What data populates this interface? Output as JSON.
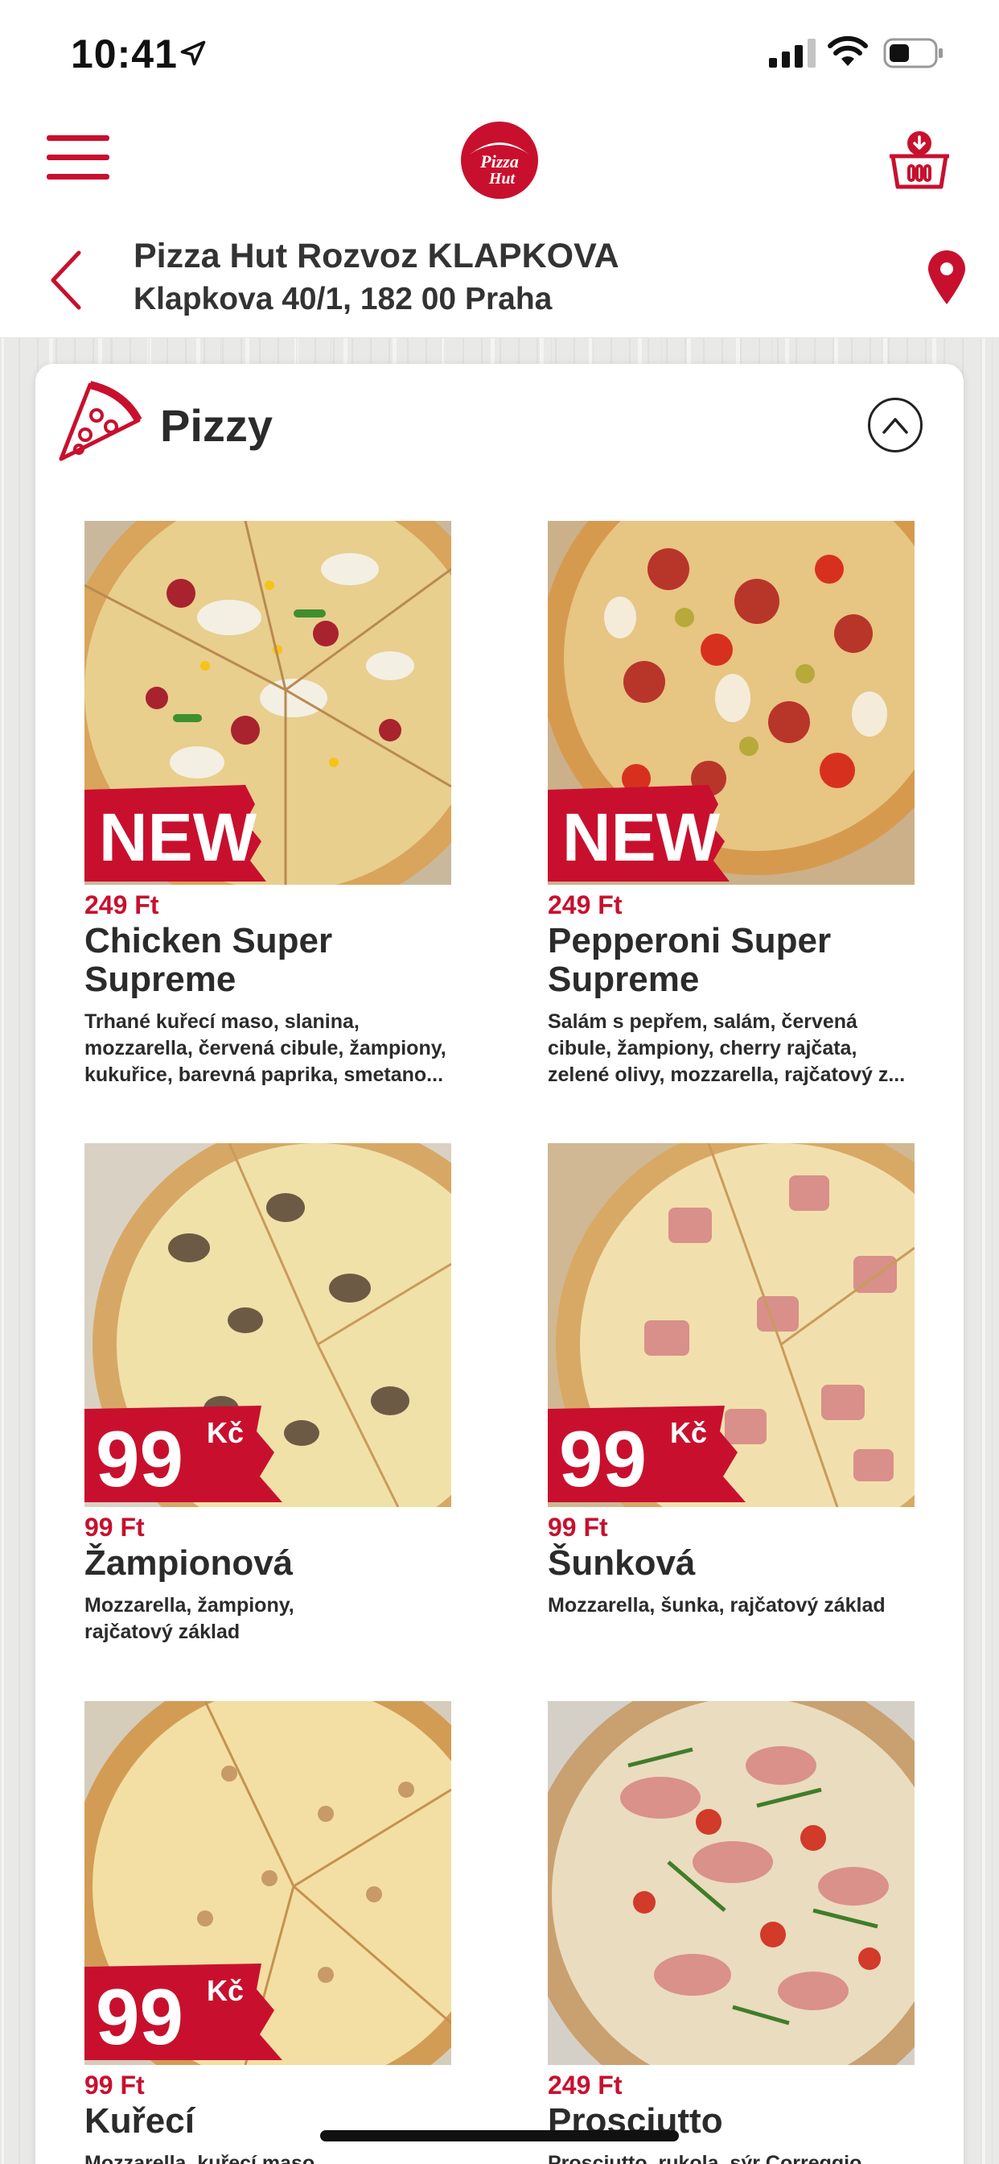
{
  "status_bar": {
    "time": "10:41"
  },
  "header": {
    "logo_text_line1": "Pizza",
    "logo_text_line2": "Hut",
    "store_name": "Pizza Hut Rozvoz KLAPKOVA",
    "store_address": "Klapkova 40/1, 182 00 Praha"
  },
  "section": {
    "title": "Pizzy"
  },
  "products": [
    {
      "price": "249 Ft",
      "name": "Chicken Super Supreme",
      "description": "Trhané kuřecí maso, slanina, mozzarella, červená cibule, žampiony, kukuřice, barevná paprika, smetano...",
      "badge": "NEW"
    },
    {
      "price": "249 Ft",
      "name": "Pepperoni Super Supreme",
      "description": "Salám s pepřem, salám, červená cibule, žampiony, cherry rajčata, zelené olivy, mozzarella, rajčatový z...",
      "badge": "NEW"
    },
    {
      "price": "99 Ft",
      "name": "Žampionová",
      "description": "Mozzarella, žampiony, rajčatový základ",
      "badge_value": "99",
      "badge_unit": "Kč"
    },
    {
      "price": "99 Ft",
      "name": "Šunková",
      "description": "Mozzarella, šunka, rajčatový základ",
      "badge_value": "99",
      "badge_unit": "Kč"
    },
    {
      "price": "99 Ft",
      "name": "Kuřecí",
      "description": "Mozzarella, kuřecí maso",
      "badge_value": "99",
      "badge_unit": "Kč"
    },
    {
      "price": "249 Ft",
      "name": "Prosciutto",
      "description": "Prosciutto, rukola, sýr Correggio"
    }
  ],
  "colors": {
    "brand_red": "#c8102e",
    "text_dark": "#2b2b2b"
  },
  "icons": [
    "location-arrow-icon",
    "signal-icon",
    "wifi-icon",
    "battery-icon",
    "menu-icon",
    "basket-icon",
    "back-icon",
    "map-pin-icon",
    "pizza-slice-icon",
    "chevron-up-icon"
  ]
}
